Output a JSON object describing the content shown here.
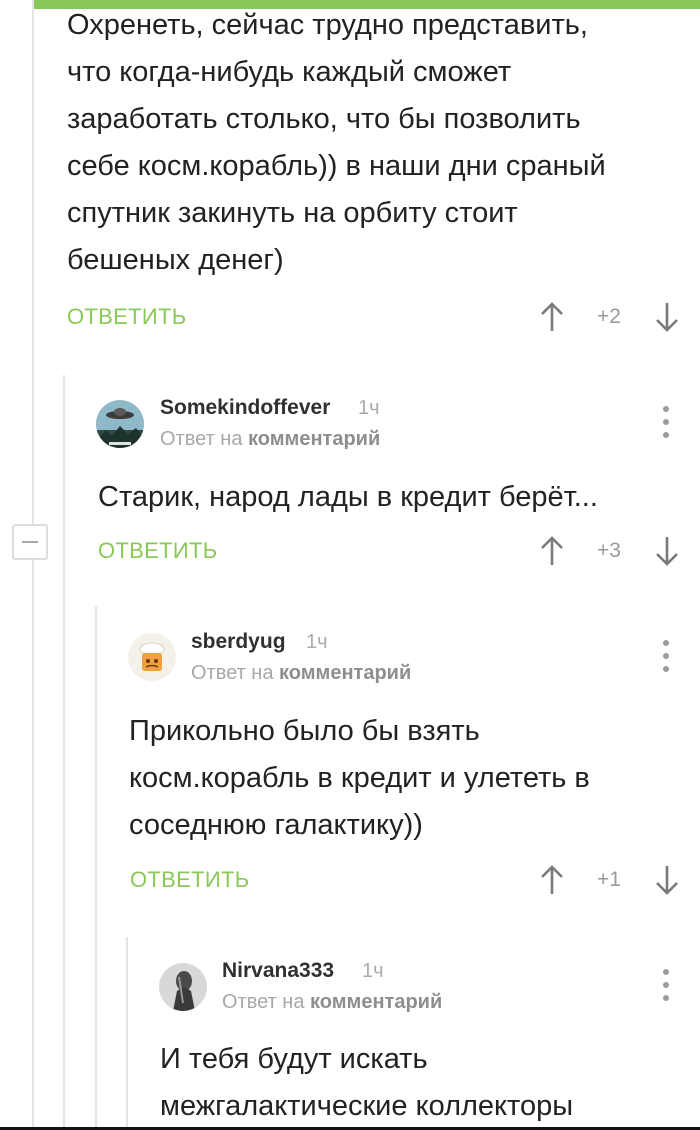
{
  "colors": {
    "accent": "#8ac858",
    "text": "#222222",
    "muted": "#9a9a9a"
  },
  "icons": {
    "up": "arrow-up-icon",
    "down": "arrow-down-icon",
    "more": "more-vertical-icon",
    "collapse": "minus-icon"
  },
  "comments": [
    {
      "text_lines": [
        "Охренеть, сейчас трудно представить,",
        "что когда-нибудь каждый сможет",
        "заработать столько, что бы позволить",
        "себе косм.корабль)) в наши дни сраный",
        "спутник закинуть на орбиту стоит",
        "бешеных денег)"
      ],
      "reply_label": "ОТВЕТИТЬ",
      "score": "+2"
    },
    {
      "username": "Somekindoffever",
      "time": "1ч",
      "reply_prefix": "Ответ на",
      "reply_target": "комментарий",
      "text_lines": [
        "Старик, народ лады в кредит берёт..."
      ],
      "reply_label": "ОТВЕТИТЬ",
      "score": "+3"
    },
    {
      "username": "sberdyug",
      "time": "1ч",
      "reply_prefix": "Ответ на",
      "reply_target": "комментарий",
      "text_lines": [
        "Прикольно было бы взять",
        "косм.корабль в кредит и улететь в",
        "соседнюю галактику))"
      ],
      "reply_label": "ОТВЕТИТЬ",
      "score": "+1"
    },
    {
      "username": "Nirvana333",
      "time": "1ч",
      "reply_prefix": "Ответ на",
      "reply_target": "комментарий",
      "text_lines": [
        "И тебя будут искать",
        "межгалактические коллекторы"
      ]
    }
  ]
}
